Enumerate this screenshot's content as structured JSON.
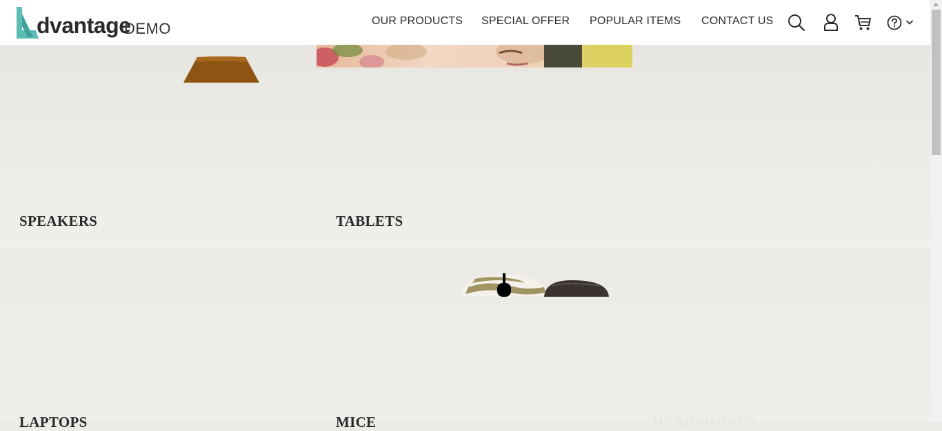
{
  "logo": {
    "main": "dvantage",
    "suffix": "DEMO",
    "accent_color": "#5dbcb4"
  },
  "nav": {
    "items": [
      "OUR PRODUCTS",
      "SPECIAL OFFER",
      "POPULAR ITEMS",
      "CONTACT US"
    ]
  },
  "icons": [
    "search-icon",
    "user-icon",
    "cart-icon",
    "help-icon",
    "chevron-down-icon"
  ],
  "categories": {
    "speakers": "SPEAKERS",
    "tablets": "TABLETS",
    "laptops": "LAPTOPS",
    "mice": "MICE",
    "headphones": "HEADPHONES"
  }
}
